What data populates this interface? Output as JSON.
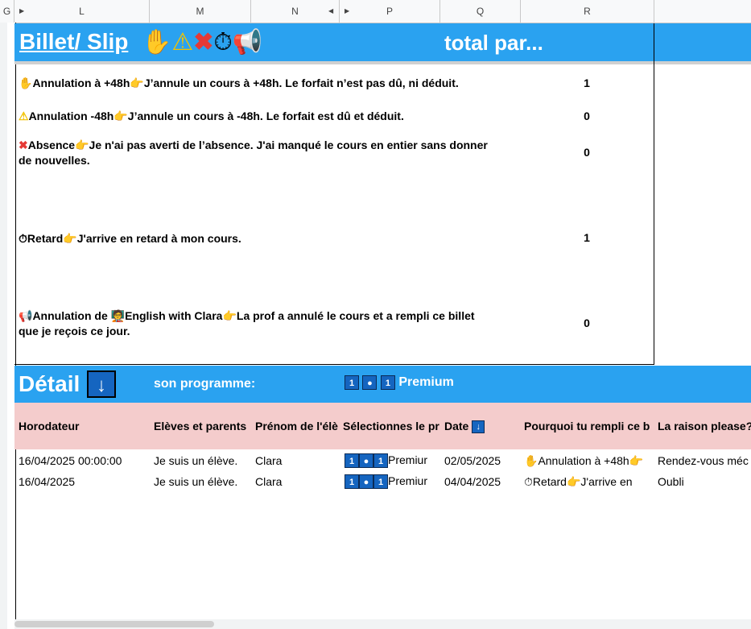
{
  "colors": {
    "blue_bar": "#2aa2f0",
    "pink_header": "#f4cccc",
    "icon_box": "#1565c0"
  },
  "columns": [
    "G",
    "L",
    "M",
    "N",
    "P",
    "Q",
    "R"
  ],
  "banner": {
    "title": "Billet/ Slip",
    "title_icons": [
      "raised-hand-icon",
      "warning-icon",
      "cross-mark-icon",
      "stopwatch-icon",
      "megaphone-icon"
    ],
    "total_label": "total par..."
  },
  "slips": [
    {
      "icon": "raised-hand-icon",
      "label": "Annulation à +48h",
      "text": "J’annule un cours à +48h. Le forfait n’est pas dû, ni déduit.",
      "count": "1"
    },
    {
      "icon": "warning-icon",
      "label": "Annulation -48h",
      "text": "J’annule un cours à -48h. Le forfait est dû et déduit.",
      "count": "0"
    },
    {
      "icon": "cross-mark-icon",
      "label": "Absence",
      "text": "Je n'ai pas averti de l’absence. J'ai manqué le cours en entier sans donner",
      "text2": "de nouvelles.",
      "count": "0"
    },
    {
      "icon": "stopwatch-icon",
      "label": "Retard",
      "text": "J'arrive en retard à mon cours.",
      "count": "1"
    },
    {
      "icon": "megaphone-icon",
      "label": "Annulation de ",
      "label2": "English with Clara",
      "text": "La prof a annulé le cours et a rempli ce billet",
      "text2": "que je reçois ce jour.",
      "count": "0"
    }
  ],
  "detail": {
    "title": "Détail",
    "arrow": "↓",
    "program_label": "son programme:",
    "program_value": "Premium",
    "program_boxes": [
      "1",
      "●",
      "1"
    ]
  },
  "table": {
    "headers": [
      "Horodateur",
      "Elèves et parents",
      "Prénom de l'élè",
      "Sélectionnes le pr",
      "Date",
      "Pourquoi tu rempli ce b",
      "La raison please?"
    ],
    "rows": [
      {
        "horodateur": "16/04/2025 00:00:00",
        "eleves": "Je suis un élève.",
        "prenom": "Clara",
        "programme": "Premiur",
        "date": "02/05/2025",
        "pourquoi": "Annulation à +48h",
        "pourquoi_icon": "raised-hand-icon",
        "raison": "Rendez-vous méc"
      },
      {
        "horodateur": "16/04/2025",
        "eleves": "Je suis un élève.",
        "prenom": "Clara",
        "programme": "Premiur",
        "date": "04/04/2025",
        "pourquoi": "Retard",
        "pourquoi_icon": "stopwatch-icon",
        "pourquoi_extra": "J'arrive en",
        "raison": "Oubli"
      }
    ]
  }
}
